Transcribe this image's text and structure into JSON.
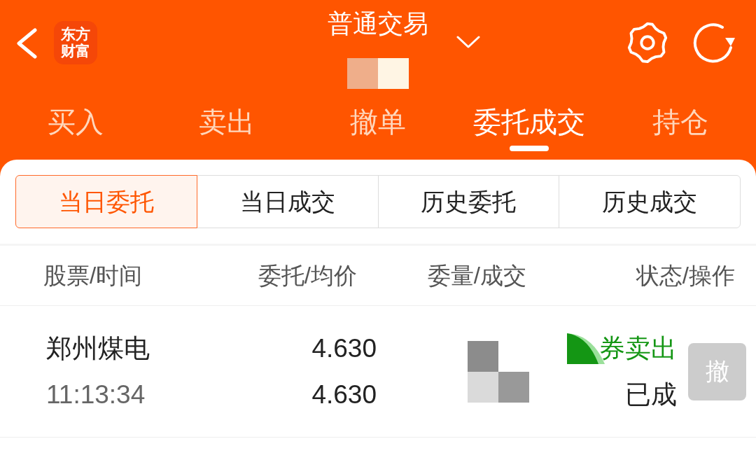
{
  "top_bar": {
    "logo": {
      "text": "东方财富"
    },
    "title": "普通交易"
  },
  "main_tabs": [
    {
      "label": "买入",
      "selected": false
    },
    {
      "label": "卖出",
      "selected": false
    },
    {
      "label": "撤单",
      "selected": false
    },
    {
      "label": "委托成交",
      "selected": true
    },
    {
      "label": "持仓",
      "selected": false
    }
  ],
  "sub_tabs": [
    {
      "label": "当日委托",
      "selected": true
    },
    {
      "label": "当日成交",
      "selected": false
    },
    {
      "label": "历史委托",
      "selected": false
    },
    {
      "label": "历史成交",
      "selected": false
    }
  ],
  "table": {
    "columns": [
      "股票/时间",
      "委托/均价",
      "委量/成交",
      "状态/操作"
    ],
    "rows": [
      {
        "stock": "郑州煤电",
        "time": "11:13:34",
        "price": "4.630",
        "avg_price": "4.630",
        "order_type": "券卖出",
        "status": "已成",
        "action": {
          "label": "撤",
          "disabled": true
        }
      }
    ]
  }
}
